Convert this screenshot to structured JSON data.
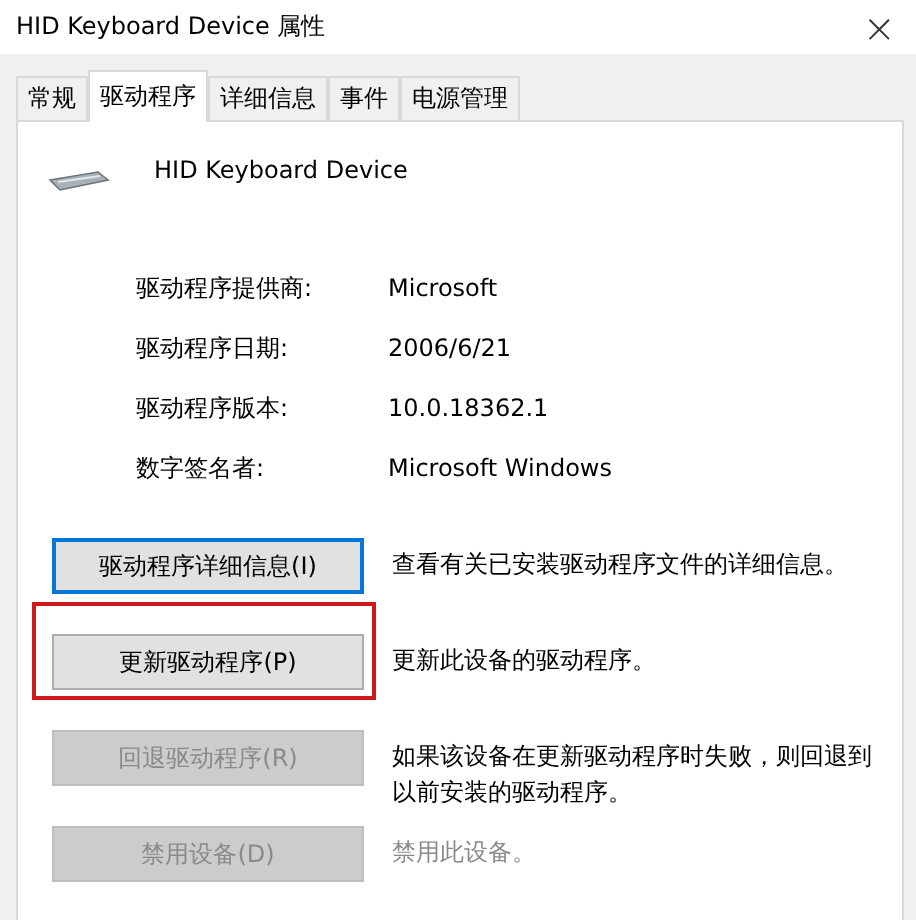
{
  "window": {
    "title": "HID Keyboard Device 属性",
    "close": "×"
  },
  "tabs": [
    {
      "label": "常规",
      "selected": false
    },
    {
      "label": "驱动程序",
      "selected": true
    },
    {
      "label": "详细信息",
      "selected": false
    },
    {
      "label": "事件",
      "selected": false
    },
    {
      "label": "电源管理",
      "selected": false
    }
  ],
  "device_name": "HID Keyboard Device",
  "properties": [
    {
      "label": "驱动程序提供商:",
      "value": "Microsoft"
    },
    {
      "label": "驱动程序日期:",
      "value": "2006/6/21"
    },
    {
      "label": "驱动程序版本:",
      "value": "10.0.18362.1"
    },
    {
      "label": "数字签名者:",
      "value": "Microsoft Windows"
    }
  ],
  "actions": [
    {
      "button": "驱动程序详细信息(I)",
      "focused": true,
      "disabled": false,
      "highlighted": false,
      "description": "查看有关已安装驱动程序文件的详细信息。",
      "description_disabled": false
    },
    {
      "button": "更新驱动程序(P)",
      "focused": false,
      "disabled": false,
      "highlighted": true,
      "description": "更新此设备的驱动程序。",
      "description_disabled": false
    },
    {
      "button": "回退驱动程序(R)",
      "focused": false,
      "disabled": true,
      "highlighted": false,
      "description": "如果该设备在更新驱动程序时失败，则回退到以前安装的驱动程序。",
      "description_disabled": false
    },
    {
      "button": "禁用设备(D)",
      "focused": false,
      "disabled": true,
      "highlighted": false,
      "description": "禁用此设备。",
      "description_disabled": true
    }
  ]
}
